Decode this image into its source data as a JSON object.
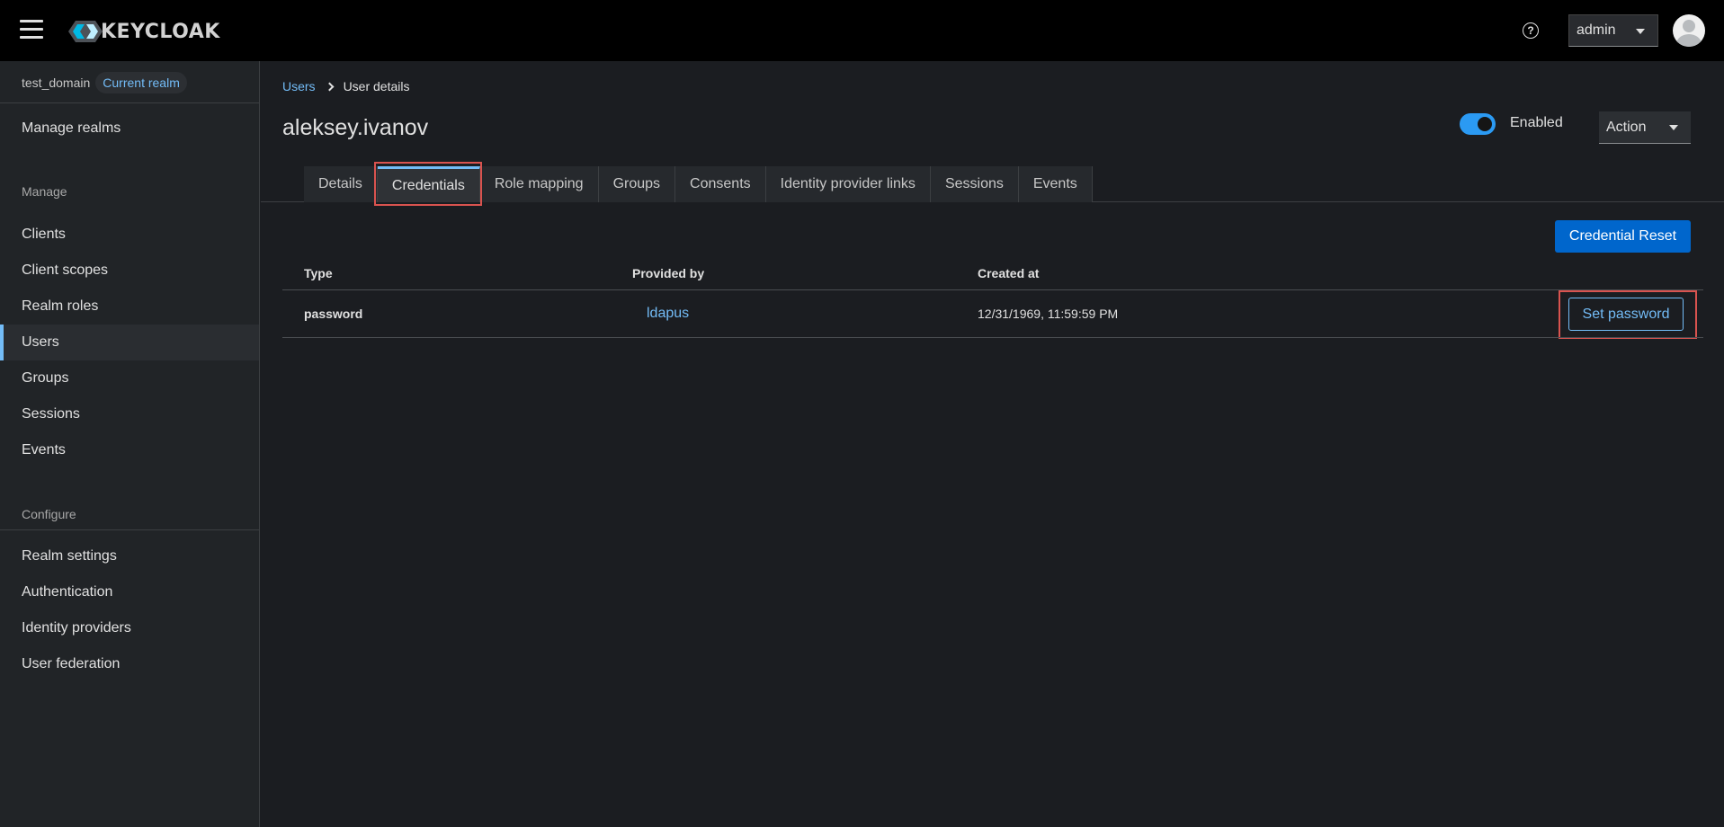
{
  "header": {
    "logo_text": "KEYCLOAK",
    "user_menu": "admin"
  },
  "sidebar": {
    "realm_name": "test_domain",
    "realm_badge": "Current realm",
    "manage_realms": "Manage realms",
    "manage_section": "Manage",
    "manage_items": [
      "Clients",
      "Client scopes",
      "Realm roles",
      "Users",
      "Groups",
      "Sessions",
      "Events"
    ],
    "active_item": "Users",
    "configure_section": "Configure",
    "configure_items": [
      "Realm settings",
      "Authentication",
      "Identity providers",
      "User federation"
    ]
  },
  "breadcrumb": {
    "parent": "Users",
    "current": "User details"
  },
  "page": {
    "title": "aleksey.ivanov",
    "enabled_label": "Enabled",
    "enabled": true,
    "action_label": "Action"
  },
  "tabs": [
    "Details",
    "Credentials",
    "Role mapping",
    "Groups",
    "Consents",
    "Identity provider links",
    "Sessions",
    "Events"
  ],
  "active_tab": "Credentials",
  "credentials": {
    "reset_button": "Credential Reset",
    "columns": [
      "Type",
      "Provided by",
      "Created at"
    ],
    "rows": [
      {
        "type": "password",
        "provided_by": "ldapus",
        "created_at": "12/31/1969, 11:59:59 PM",
        "action": "Set password"
      }
    ]
  },
  "colors": {
    "accent": "#73bcf7",
    "primary": "#0066cc",
    "highlight": "#d9534f"
  }
}
